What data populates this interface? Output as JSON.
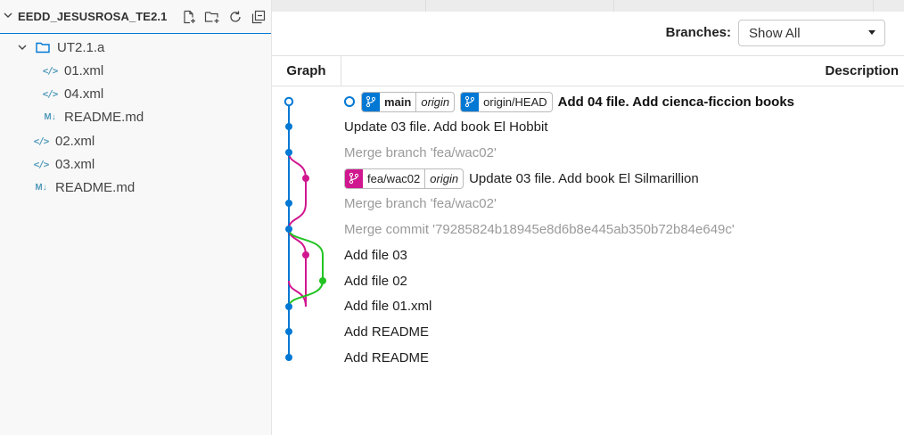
{
  "explorer": {
    "title": "EEDD_JESUSROSA_TE2.1",
    "actions": [
      "new-file-icon",
      "new-folder-icon",
      "refresh-icon",
      "collapse-all-icon"
    ],
    "tree": [
      {
        "label": "UT2.1.a",
        "type": "folder",
        "level": 1,
        "expanded": true
      },
      {
        "label": "01.xml",
        "type": "xml",
        "level": 2
      },
      {
        "label": "04.xml",
        "type": "xml",
        "level": 2
      },
      {
        "label": "README.md",
        "type": "md",
        "level": 2
      },
      {
        "label": "02.xml",
        "type": "xml",
        "level": 1
      },
      {
        "label": "03.xml",
        "type": "xml",
        "level": 1
      },
      {
        "label": "README.md",
        "type": "md",
        "level": 1
      }
    ]
  },
  "graph_view": {
    "branches_label": "Branches:",
    "branch_select_value": "Show All",
    "col_graph": "Graph",
    "col_description": "Description",
    "colors": {
      "main": "#0078d4",
      "fea": "#d0178f",
      "green": "#22c322"
    },
    "commits": [
      {
        "message": "Add 04 file. Add cienca-ficcion books",
        "style": "bold",
        "refs": [
          {
            "name": "main",
            "origin": "origin",
            "color": "#0078d4",
            "bold": true
          },
          {
            "name": "origin/HEAD",
            "origin": "",
            "color": "#0078d4",
            "bold": false
          }
        ]
      },
      {
        "message": "Update 03 file. Add book El Hobbit",
        "style": "normal",
        "refs": []
      },
      {
        "message": "Merge branch 'fea/wac02'",
        "style": "dim",
        "refs": []
      },
      {
        "message": "Update 03 file. Add book El Silmarillion",
        "style": "normal",
        "refs": [
          {
            "name": "fea/wac02",
            "origin": "origin",
            "color": "#d0178f",
            "bold": false
          }
        ]
      },
      {
        "message": "Merge branch 'fea/wac02'",
        "style": "dim",
        "refs": []
      },
      {
        "message": "Merge commit '79285824b18945e8d6b8e445ab350b72b84e649c'",
        "style": "dim",
        "refs": []
      },
      {
        "message": "Add file 03",
        "style": "normal",
        "refs": []
      },
      {
        "message": "Add file 02",
        "style": "normal",
        "refs": []
      },
      {
        "message": "Add file 01.xml",
        "style": "normal",
        "refs": []
      },
      {
        "message": "Add README",
        "style": "normal",
        "refs": []
      },
      {
        "message": "Add README",
        "style": "normal",
        "refs": []
      }
    ]
  }
}
